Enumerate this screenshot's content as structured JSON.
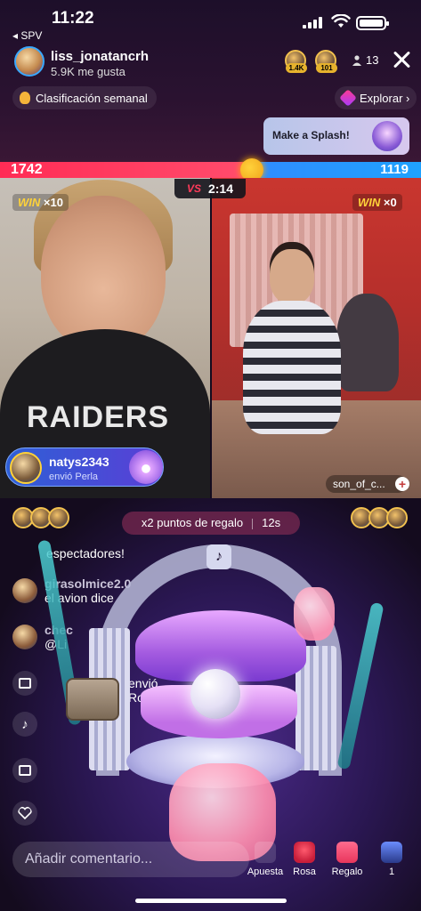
{
  "status_bar": {
    "time": "11:22",
    "back_app": "◂ SPV"
  },
  "host": {
    "name": "liss_jonatancrh",
    "likes": "5.9K me gusta"
  },
  "viewers": {
    "badges": [
      {
        "label": "1.4K"
      },
      {
        "label": "101"
      }
    ],
    "count": "13"
  },
  "chips": {
    "weekly": "Clasificación semanal",
    "explore": "Explorar ›"
  },
  "splash_card": {
    "label": "Make a Splash!"
  },
  "battle": {
    "score_left": "1742",
    "score_right": "1119",
    "left_fraction": 0.609,
    "timer": "2:14",
    "vs": "VS",
    "win_left_word": "WIN",
    "win_left_count": "×10",
    "win_right_word": "WIN",
    "win_right_count": "×0"
  },
  "left_video": {
    "shirt_text": "RAIDERS"
  },
  "gift_notice": {
    "user": "natys2343",
    "text": "envió Perla"
  },
  "guest": {
    "name": "son_of_c...",
    "plus": "+"
  },
  "multiplier": {
    "label": "x2 puntos de regalo",
    "seconds": "12s"
  },
  "chat": [
    {
      "user": "",
      "text": "espectadores!"
    },
    {
      "user": "girasolmice2.0",
      "text": "el avion dice"
    },
    {
      "user": "chec",
      "text": "@Li"
    },
    {
      "user": "",
      "text": "envió Rosa"
    }
  ],
  "arch_logo": "♪",
  "comment": {
    "placeholder": "Añadir comentario..."
  },
  "bottom_bar": [
    {
      "label": "Apuesta"
    },
    {
      "label": "Rosa"
    },
    {
      "label": "Regalo"
    },
    {
      "label": "1"
    }
  ],
  "colors": {
    "red_team": "#ff2c55",
    "blue_team": "#2f8cff",
    "badge_gold": "#e6b22d"
  }
}
